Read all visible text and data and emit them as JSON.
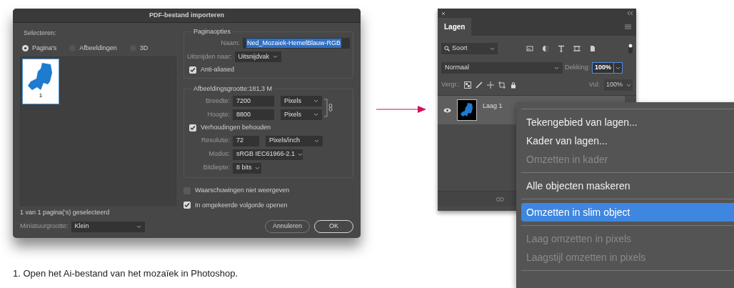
{
  "dialog": {
    "title": "PDF-bestand importeren",
    "select": {
      "label": "Selecteren:",
      "options": [
        {
          "label": "Pagina's",
          "selected": true
        },
        {
          "label": "Afbeeldingen",
          "selected": false
        },
        {
          "label": "3D",
          "selected": false
        }
      ],
      "thumbnails": [
        {
          "label": "1",
          "selected": true
        }
      ],
      "status": "1 van 1 pagina('s) geselecteerd",
      "thumb_size": {
        "label": "Miniatuurgrootte:",
        "value": "Klein"
      }
    },
    "page_options": {
      "title": "Paginaopties",
      "name": {
        "label": "Naam:",
        "value": "Ned_Mozaiek-HemelBlauw-RGB"
      },
      "crop": {
        "label": "Uitsnijden naar:",
        "value": "Uitsnijdvak"
      },
      "anti_aliased": {
        "label": "Anti-aliased",
        "checked": true
      }
    },
    "image_size": {
      "title": "Afbeeldingsgrootte:181,3 M",
      "width": {
        "label": "Breedte:",
        "value": "7200",
        "unit": "Pixels"
      },
      "height": {
        "label": "Hoogte:",
        "value": "8800",
        "unit": "Pixels"
      },
      "constrain": {
        "label": "Verhoudingen behouden",
        "checked": true
      },
      "resolution": {
        "label": "Resolutie:",
        "value": "72",
        "unit": "Pixels/inch"
      },
      "mode": {
        "label": "Modus:",
        "value": "sRGB IEC61966-2.1"
      },
      "depth": {
        "label": "Bitdiepte:",
        "value": "8 bits"
      }
    },
    "suppress_warnings": {
      "label": "Waarschuwingen niet weergeven",
      "checked": false
    },
    "reverse_order": {
      "label": "In omgekeerde volgorde openen",
      "checked": true
    },
    "buttons": [
      {
        "label": "Annuleren",
        "kind": "secondary"
      },
      {
        "label": "OK",
        "kind": "primary"
      }
    ]
  },
  "caption": "1. Open het Ai-bestand van het mozaïek in Photoshop.",
  "layers_panel": {
    "tab": "Lagen",
    "filter": "Soort",
    "blend_mode": "Normaal",
    "opacity": {
      "label": "Dekking:",
      "value": "100%"
    },
    "lock_label": "Vergr.:",
    "fill": {
      "label": "Vul:",
      "value": "100%"
    },
    "layers": [
      {
        "name": "Laag 1",
        "visible": true,
        "selected": true
      }
    ]
  },
  "context_menu": [
    [
      {
        "label": "Tekengebied van lagen...",
        "disabled": false,
        "selected": false
      },
      {
        "label": "Kader van lagen...",
        "disabled": false,
        "selected": false
      },
      {
        "label": "Omzetten in kader",
        "disabled": true,
        "selected": false
      }
    ],
    [
      {
        "label": "Alle objecten maskeren",
        "disabled": false,
        "selected": false
      }
    ],
    [
      {
        "label": "Omzetten in slim object",
        "disabled": false,
        "selected": true
      }
    ],
    [
      {
        "label": "Laag omzetten in pixels",
        "disabled": true,
        "selected": false
      },
      {
        "label": "Laagstijl omzetten in pixels",
        "disabled": true,
        "selected": false
      }
    ]
  ]
}
